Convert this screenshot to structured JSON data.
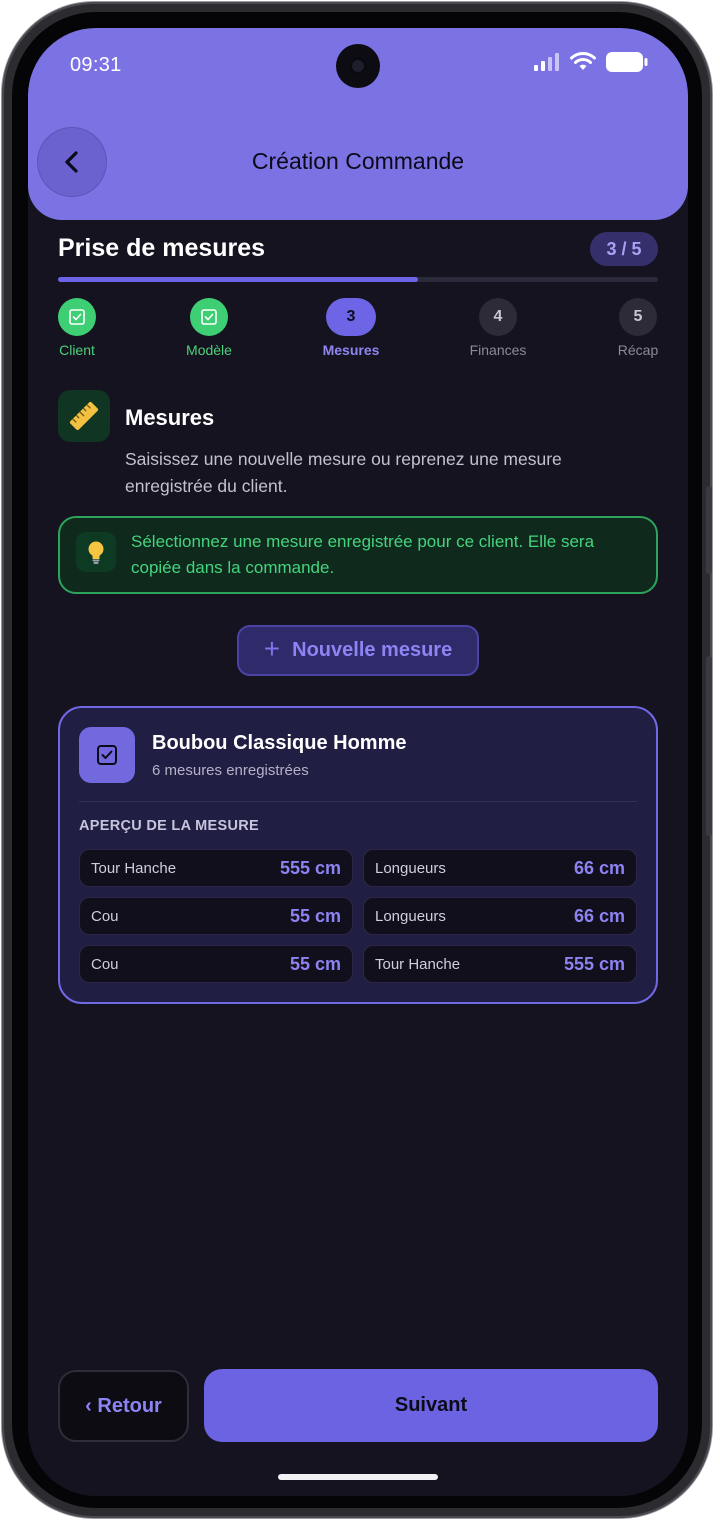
{
  "status_bar": {
    "time": "09:31"
  },
  "header": {
    "title": "Création Commande"
  },
  "step": {
    "title": "Prise de mesures",
    "counter": "3 / 5",
    "progress_fraction": 0.6
  },
  "steps": [
    {
      "number": "1",
      "label": "Client",
      "state": "done"
    },
    {
      "number": "2",
      "label": "Modèle",
      "state": "done"
    },
    {
      "number": "3",
      "label": "Mesures",
      "state": "active"
    },
    {
      "number": "4",
      "label": "Finances",
      "state": "todo"
    },
    {
      "number": "5",
      "label": "Récap",
      "state": "todo"
    }
  ],
  "section": {
    "title": "Mesures",
    "description": "Saisissez une nouvelle mesure ou reprenez une mesure enregistrée du client.",
    "icon": "ruler-icon"
  },
  "tip": {
    "text": "Sélectionnez une mesure enregistrée pour ce client. Elle sera copiée dans la commande.",
    "icon": "lightbulb-icon"
  },
  "new_measure_button": {
    "label": "Nouvelle mesure"
  },
  "measure_card": {
    "title": "Boubou Classique Homme",
    "subtitle": "6 mesures enregistrées",
    "preview_title": "APERÇU DE LA MESURE",
    "measures": [
      {
        "name": "Tour Hanche",
        "value": "555 cm"
      },
      {
        "name": "Longueurs",
        "value": "66 cm"
      },
      {
        "name": "Cou",
        "value": "55 cm"
      },
      {
        "name": "Longueurs",
        "value": "66 cm"
      },
      {
        "name": "Cou",
        "value": "55 cm"
      },
      {
        "name": "Tour Hanche",
        "value": "555 cm"
      }
    ]
  },
  "footer": {
    "back_label": "‹ Retour",
    "next_label": "Suivant"
  },
  "colors": {
    "accent": "#6c63e2",
    "header": "#7b72e3",
    "background": "#14131f",
    "success": "#3ecf74"
  }
}
